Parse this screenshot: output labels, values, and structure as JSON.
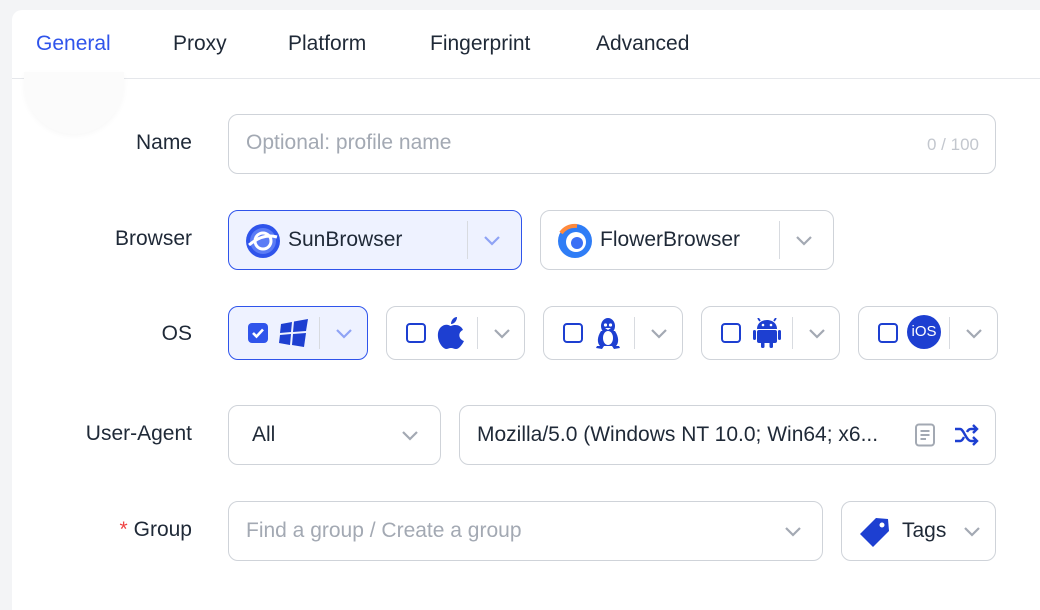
{
  "tabs": [
    {
      "label": "General",
      "active": true
    },
    {
      "label": "Proxy",
      "active": false
    },
    {
      "label": "Platform",
      "active": false
    },
    {
      "label": "Fingerprint",
      "active": false
    },
    {
      "label": "Advanced",
      "active": false
    }
  ],
  "form": {
    "name": {
      "label": "Name",
      "placeholder": "Optional: profile name",
      "counter": "0 / 100",
      "value": ""
    },
    "browser": {
      "label": "Browser",
      "options": [
        {
          "name": "SunBrowser",
          "selected": true,
          "icon": "sunbrowser-icon"
        },
        {
          "name": "FlowerBrowser",
          "selected": false,
          "icon": "flowerbrowser-icon"
        }
      ]
    },
    "os": {
      "label": "OS",
      "options": [
        {
          "name": "windows",
          "checked": true,
          "icon": "windows-icon"
        },
        {
          "name": "macos",
          "checked": false,
          "icon": "apple-icon"
        },
        {
          "name": "linux",
          "checked": false,
          "icon": "linux-icon"
        },
        {
          "name": "android",
          "checked": false,
          "icon": "android-icon"
        },
        {
          "name": "ios",
          "checked": false,
          "icon": "ios-icon",
          "badge": "iOS"
        }
      ]
    },
    "user_agent": {
      "label": "User-Agent",
      "filter": "All",
      "value": "Mozilla/5.0 (Windows NT 10.0; Win64; x6..."
    },
    "group": {
      "label": "Group",
      "required_mark": "*",
      "placeholder": "Find a group / Create a group",
      "tags_label": "Tags"
    }
  },
  "colors": {
    "accent": "#2f54eb",
    "required": "#ef4444",
    "border": "#cfd3d9"
  }
}
